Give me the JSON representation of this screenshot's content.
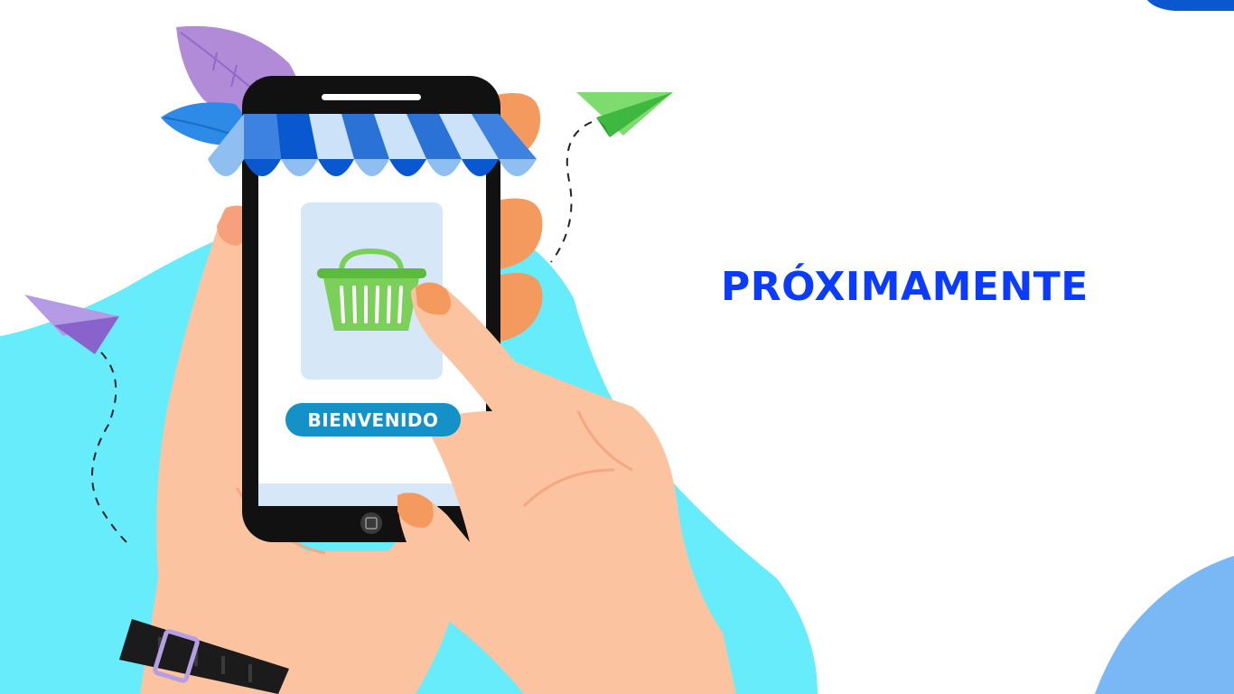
{
  "headline": "PRÓXIMAMENTE",
  "phone_button": "BIENVENIDO",
  "colors": {
    "headline": "#0a3bff",
    "blob_cyan": "#66ecfb",
    "blob_blue_corner": "#7ab8f5",
    "skin": "#fcc3a0",
    "skin_shadow": "#f7a07c",
    "nail": "#f59a5e",
    "phone_body": "#111111",
    "screen": "#ffffff",
    "card": "#d6e8f8",
    "basket": "#7bd05a",
    "button": "#1492c8",
    "awning_dark": "#0a58cf",
    "awning_light": "#8fbef0",
    "plane_green": "#4bd04b",
    "plane_purple": "#9a74d8",
    "leaf_purple": "#b18ad8",
    "leaf_blue": "#2d8ae6",
    "watch": "#1b1b1b",
    "watch_buckle": "#b49ee6"
  },
  "icons": [
    "shopping-basket-icon",
    "paper-plane-icon",
    "leaf-icon",
    "home-button-icon",
    "awning-icon"
  ]
}
